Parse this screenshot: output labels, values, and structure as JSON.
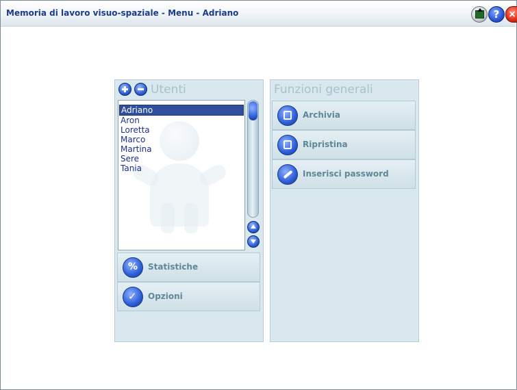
{
  "window": {
    "title": "Memoria di lavoro visuo-spaziale - Menu - Adriano",
    "export_icon": "export-icon",
    "help_label": "?",
    "close_label": "×"
  },
  "users_panel": {
    "title": "Utenti",
    "users": [
      "Adriano",
      "Aron",
      "Loretta",
      "Marco",
      "Martina",
      "Sere",
      "Tania"
    ],
    "selected_user": "Adriano",
    "buttons": [
      {
        "label": "Statistiche",
        "icon": "percent-icon",
        "glyph": "%"
      },
      {
        "label": "Opzioni",
        "icon": "checkbox-icon",
        "glyph": "✓"
      }
    ]
  },
  "general_panel": {
    "title": "Funzioni generali",
    "buttons": [
      {
        "label": "Archivia",
        "icon": "save-archive-icon"
      },
      {
        "label": "Ripristina",
        "icon": "restore-icon"
      },
      {
        "label": "Inserisci password",
        "icon": "brush-password-icon"
      }
    ]
  },
  "colors": {
    "title_text": "#1a3c8a",
    "panel_bg": "#d8e8ee",
    "selected_row": "#2f4e9c",
    "button_label": "#5f8797"
  }
}
